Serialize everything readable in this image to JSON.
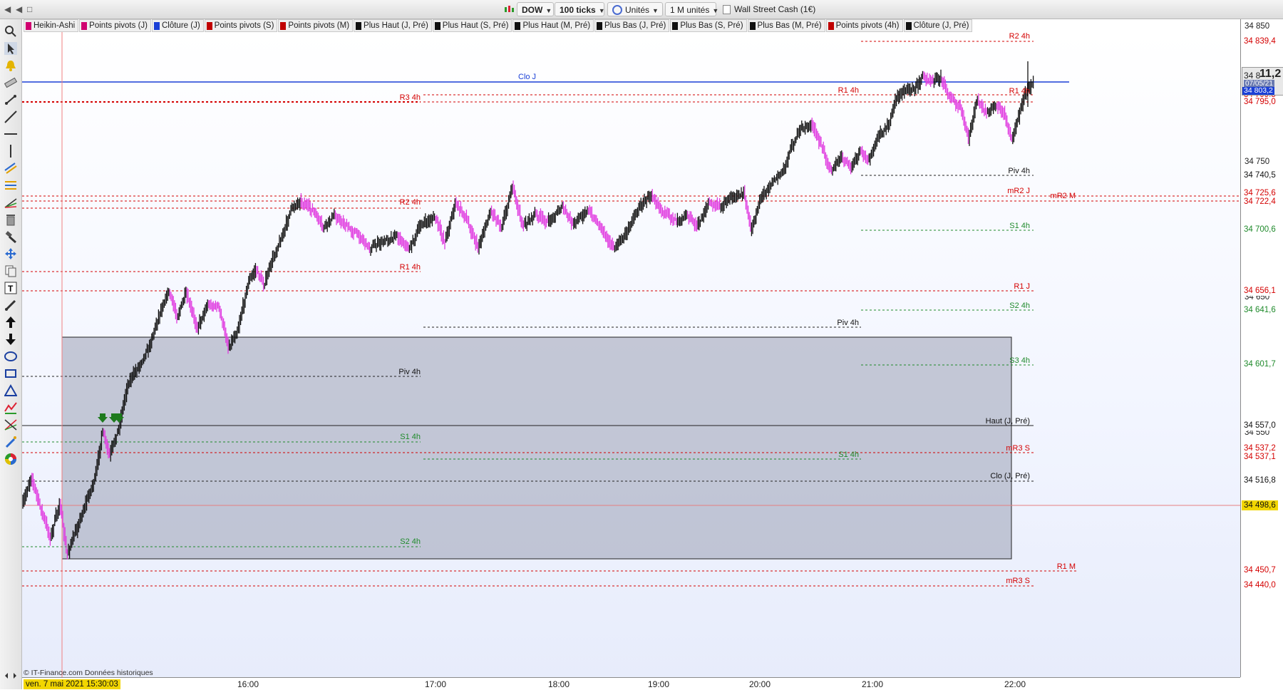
{
  "window": {
    "controls": [
      "◀",
      "□"
    ]
  },
  "toolbar_top": {
    "symbol": "DOW",
    "tick_mode": "100 ticks",
    "units": "Unités",
    "volume": "1 M unités",
    "instrument": "Wall Street Cash (1€)"
  },
  "legend": [
    {
      "label": "Heikin-Ashi",
      "color": "#d0006f"
    },
    {
      "label": "Points pivots (J)",
      "color": "#d0006f"
    },
    {
      "label": "Clôture (J)",
      "color": "#1a3fd6"
    },
    {
      "label": "Points pivots (S)",
      "color": "#c00000"
    },
    {
      "label": "Points pivots (M)",
      "color": "#c00000"
    },
    {
      "label": "Plus Haut (J, Pré)",
      "color": "#111111"
    },
    {
      "label": "Plus Haut (S, Pré)",
      "color": "#111111"
    },
    {
      "label": "Plus Haut (M, Pré)",
      "color": "#111111"
    },
    {
      "label": "Plus Bas (J, Pré)",
      "color": "#111111"
    },
    {
      "label": "Plus Bas (S, Pré)",
      "color": "#111111"
    },
    {
      "label": "Plus Bas (M, Pré)",
      "color": "#111111"
    },
    {
      "label": "Points pivots (4h)",
      "color": "#c00000"
    },
    {
      "label": "Clôture (J, Pré)",
      "color": "#111111"
    }
  ],
  "price_axis": {
    "ticks": [
      "34 850",
      "34 750",
      "34 650",
      "34 550"
    ],
    "current_price_prefix": "34 8",
    "current_price_big": "11,2",
    "current_date": "07/05/21",
    "current_sub": "34 803,2"
  },
  "price_tags": [
    {
      "text": "34 839,4",
      "color": "#d40000"
    },
    {
      "text": "34 799,5",
      "color": "#d40000"
    },
    {
      "text": "34 795,0",
      "color": "#d40000"
    },
    {
      "text": "34 740,5",
      "color": "#111111"
    },
    {
      "text": "34 725,6",
      "color": "#d40000"
    },
    {
      "text": "34 722,4",
      "color": "#d40000"
    },
    {
      "text": "34 700,6",
      "color": "#1f8a2b"
    },
    {
      "text": "34 656,1",
      "color": "#d40000"
    },
    {
      "text": "34 641,6",
      "color": "#1f8a2b"
    },
    {
      "text": "34 601,7",
      "color": "#1f8a2b"
    },
    {
      "text": "34 557,0",
      "color": "#111111"
    },
    {
      "text": "34 537,2",
      "color": "#d40000"
    },
    {
      "text": "34 537,1",
      "color": "#d40000"
    },
    {
      "text": "34 516,8",
      "color": "#111111"
    },
    {
      "text": "34 498,6",
      "color": "#111111"
    },
    {
      "text": "34 450,7",
      "color": "#d40000"
    },
    {
      "text": "34 440,0",
      "color": "#d40000"
    }
  ],
  "level_labels": [
    {
      "text": "R2 4h",
      "color": "#d40000"
    },
    {
      "text": "Clo J",
      "color": "#1a3fd6"
    },
    {
      "text": "R1 4h",
      "color": "#d40000"
    },
    {
      "text": "R3 4h",
      "color": "#d40000"
    },
    {
      "text": "R1 4h",
      "color": "#d40000"
    },
    {
      "text": "Piv 4h",
      "color": "#111111"
    },
    {
      "text": "mR2 J",
      "color": "#d40000"
    },
    {
      "text": "mR2 M",
      "color": "#d40000"
    },
    {
      "text": "R2 4h",
      "color": "#d40000"
    },
    {
      "text": "S1 4h",
      "color": "#1f8a2b"
    },
    {
      "text": "R1 4h",
      "color": "#d40000"
    },
    {
      "text": "R1 J",
      "color": "#d40000"
    },
    {
      "text": "S2 4h",
      "color": "#1f8a2b"
    },
    {
      "text": "Piv 4h",
      "color": "#111111"
    },
    {
      "text": "S3 4h",
      "color": "#1f8a2b"
    },
    {
      "text": "Piv 4h",
      "color": "#111111"
    },
    {
      "text": "Haut (J, Pré)",
      "color": "#111111"
    },
    {
      "text": "S1 4h",
      "color": "#1f8a2b"
    },
    {
      "text": "S1 4h",
      "color": "#1f8a2b"
    },
    {
      "text": "mR3 S",
      "color": "#d40000"
    },
    {
      "text": "Clo (J, Pré)",
      "color": "#111111"
    },
    {
      "text": "S2 4h",
      "color": "#1f8a2b"
    },
    {
      "text": "R1 M",
      "color": "#d40000"
    },
    {
      "text": "mR3 S",
      "color": "#d40000"
    }
  ],
  "time_axis": {
    "cursor_date": "ven. 7 mai 2021 15:30:03",
    "labels": [
      "16:00",
      "17:00",
      "18:00",
      "19:00",
      "20:00",
      "21:00",
      "22:00"
    ]
  },
  "source_note": "© IT-Finance.com  Données historiques",
  "colors": {
    "bull": "#111111",
    "bear": "#e03ce0",
    "selection_fill": "#9aa0b4",
    "clo_j": "#1a3fd6"
  }
}
